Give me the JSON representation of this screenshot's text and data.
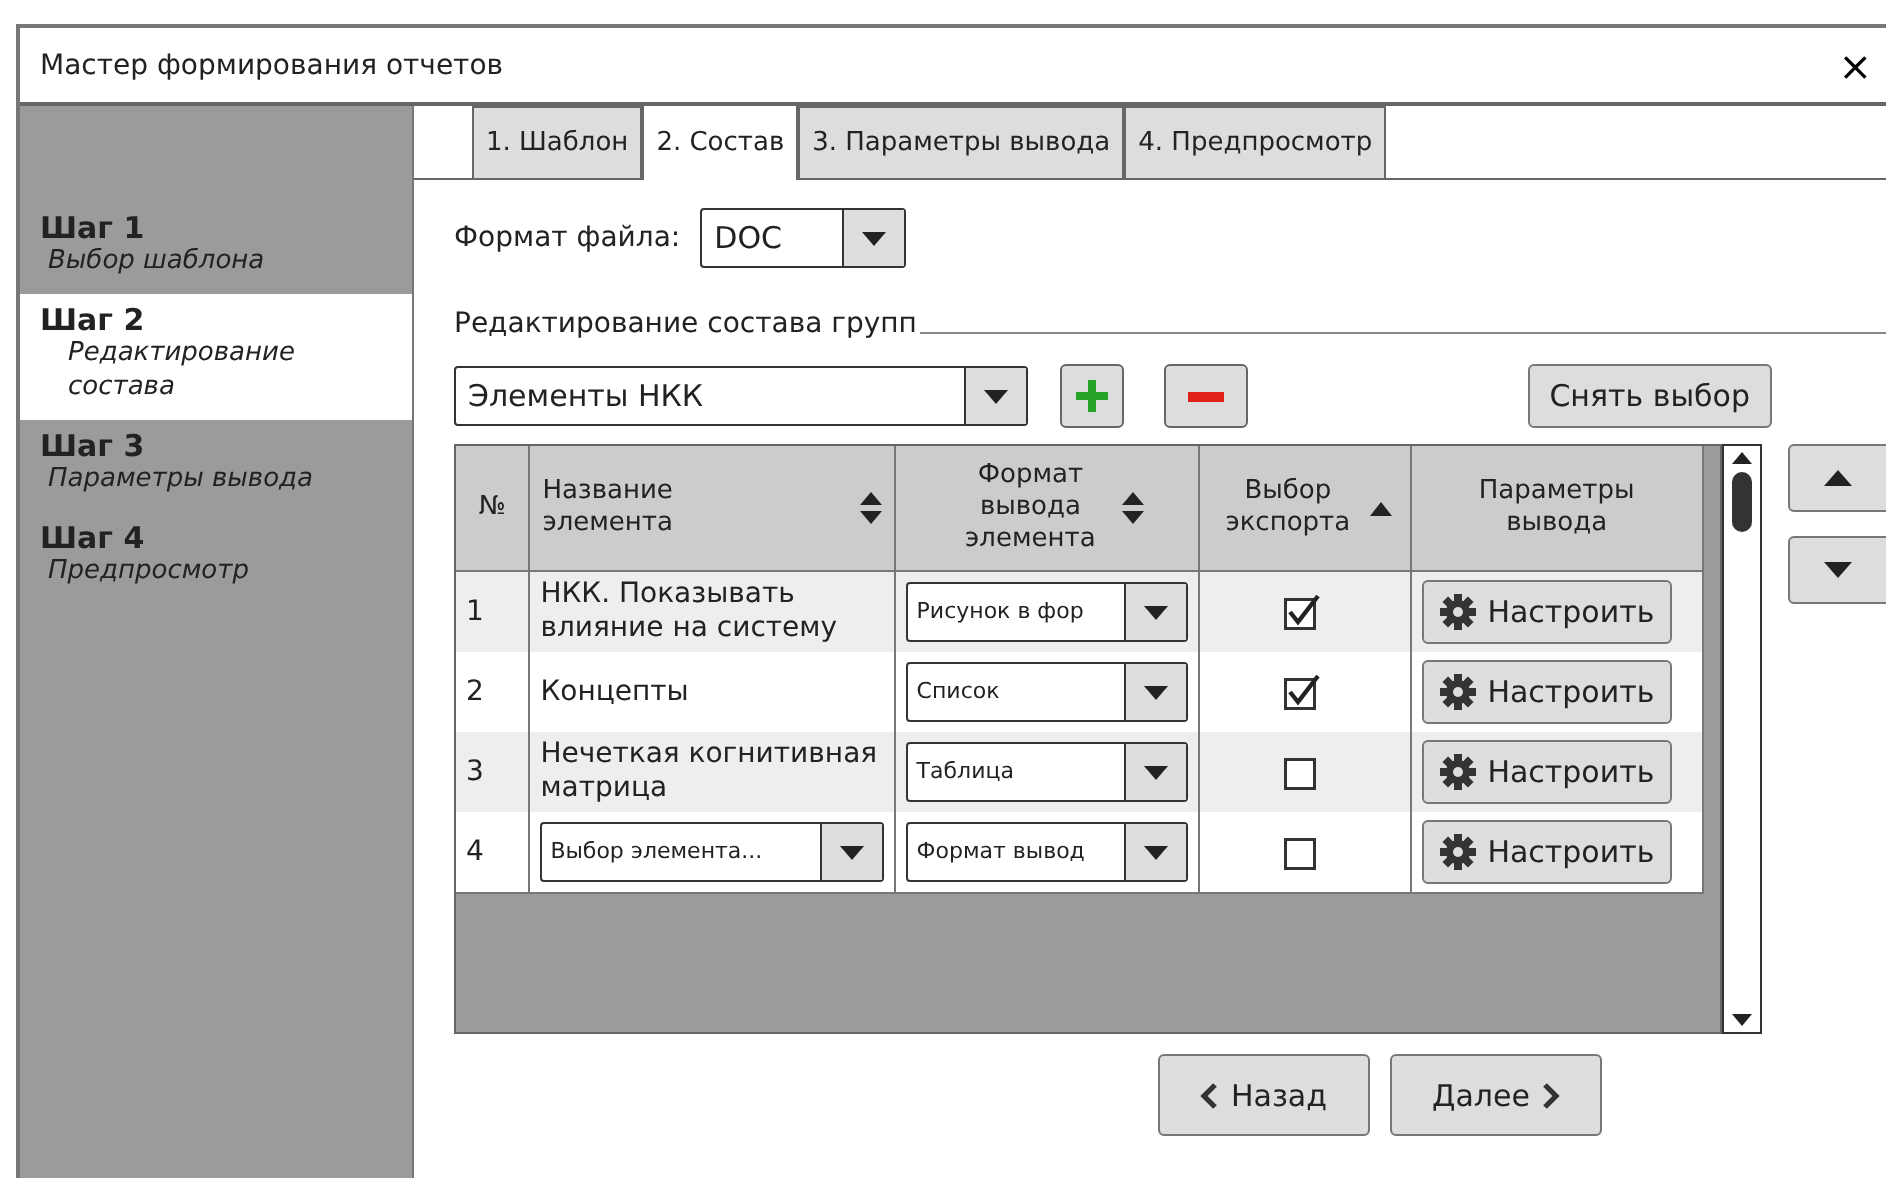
{
  "window": {
    "title": "Мастер формирования отчетов",
    "close": "×"
  },
  "steps": [
    {
      "title": "Шаг 1",
      "subtitle": "Выбор шаблона",
      "selected": false
    },
    {
      "title": "Шаг 2",
      "subtitle": "Редактирование состава",
      "selected": true
    },
    {
      "title": "Шаг 3",
      "subtitle": "Параметры вывода",
      "selected": false
    },
    {
      "title": "Шаг 4",
      "subtitle": "Предпросмотр",
      "selected": false
    }
  ],
  "tabs": [
    {
      "label": "1. Шаблон",
      "selected": false
    },
    {
      "label": "2. Состав",
      "selected": true
    },
    {
      "label": "3. Параметры вывода",
      "selected": false
    },
    {
      "label": "4. Предпросмотр",
      "selected": false
    }
  ],
  "file_format": {
    "label": "Формат файла:",
    "value": "DOC"
  },
  "group": {
    "title": "Редактирование состава групп",
    "dropdown": "Элементы НКК",
    "clear_button": "Снять выбор"
  },
  "table": {
    "columns": [
      {
        "label": "№",
        "kind": "plain"
      },
      {
        "label": "Название элемента",
        "kind": "sortable"
      },
      {
        "label": "Формат вывода элемента",
        "kind": "sortable"
      },
      {
        "label": "Выбор экспорта",
        "kind": "sorted"
      },
      {
        "label": "Параметры вывода",
        "kind": "plain"
      }
    ],
    "rows": [
      {
        "number": "1",
        "name": {
          "kind": "text",
          "value": "НКК. Показывать влияние на систему"
        },
        "format": "Рисунок в фор",
        "checked": true,
        "button": "Настроить"
      },
      {
        "number": "2",
        "name": {
          "kind": "text",
          "value": "Концепты"
        },
        "format": "Список",
        "checked": true,
        "button": "Настроить"
      },
      {
        "number": "3",
        "name": {
          "kind": "text",
          "value": "Нечеткая когнитивная матрица"
        },
        "format": "Таблица",
        "checked": false,
        "button": "Настроить"
      },
      {
        "number": "4",
        "name": {
          "kind": "dropdown",
          "value": "Выбор элемента..."
        },
        "format": "Формат вывод",
        "checked": false,
        "button": "Настроить"
      }
    ]
  },
  "nav": {
    "back": "Назад",
    "next": "Далее"
  }
}
